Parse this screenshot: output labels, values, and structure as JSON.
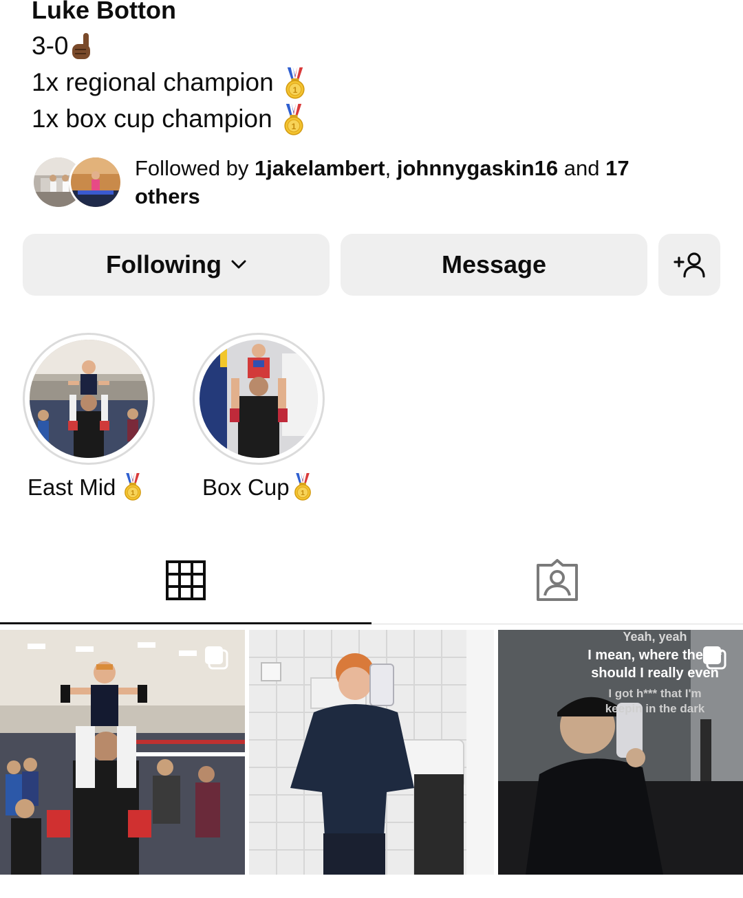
{
  "profile": {
    "name": "Luke Botton",
    "bio_line1": "3-0",
    "bio_line2": "1x regional champion",
    "bio_line3": "1x box cup champion"
  },
  "followed_by": {
    "prefix": "Followed by ",
    "user1": "1jakelambert",
    "sep": ", ",
    "user2": "johnnygaskin16",
    "and": " and ",
    "others": "17 others"
  },
  "actions": {
    "following_label": "Following",
    "message_label": "Message",
    "add_user_icon": "add-person-icon"
  },
  "highlights": [
    {
      "label": "East Mid",
      "icon": "gold-medal-icon"
    },
    {
      "label": "Box Cup",
      "icon": "gold-medal-icon"
    }
  ],
  "tabs": [
    {
      "name": "posts",
      "icon": "grid-icon",
      "active": true
    },
    {
      "name": "tagged",
      "icon": "tagged-person-icon",
      "active": false
    }
  ],
  "posts": [
    {
      "kind": "photo",
      "multi": true
    },
    {
      "kind": "photo",
      "multi": false
    },
    {
      "kind": "photo",
      "multi": true,
      "overlay_lines": [
        "Yeah, yeah",
        "I mean, where the f**",
        "should I really even",
        "I got h*** that I'm",
        "keepin in the dark"
      ]
    }
  ],
  "colors": {
    "button_bg": "#efefef",
    "text": "#0d0d0d",
    "divider": "#dbdbdb"
  }
}
